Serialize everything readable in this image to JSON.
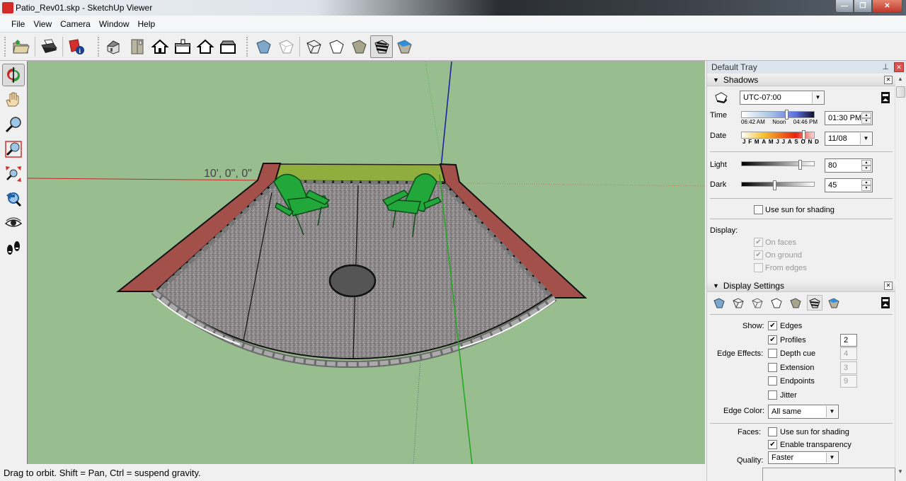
{
  "window": {
    "title": "Patio_Rev01.skp - SketchUp Viewer",
    "minimize_glyph": "—",
    "restore_glyph": "❐",
    "close_glyph": "✕"
  },
  "menu": [
    {
      "label": "File",
      "accel": "F"
    },
    {
      "label": "View",
      "accel": "V"
    },
    {
      "label": "Camera",
      "accel": "C"
    },
    {
      "label": "Window",
      "accel": "W"
    },
    {
      "label": "Help",
      "accel": "H"
    }
  ],
  "toolbar": {
    "file_tools": [
      "open-icon",
      "print-icon",
      "model-info-icon"
    ],
    "view_tools": [
      "iso-view-icon",
      "top-view-icon",
      "front-view-icon",
      "right-view-icon",
      "back-view-icon",
      "left-view-icon"
    ],
    "style_tools": [
      "xray-icon",
      "back-edges-icon",
      "wireframe-icon",
      "hidden-line-icon",
      "shaded-icon",
      "shaded-textures-icon",
      "monochrome-icon"
    ],
    "active_style": "shaded-textures-icon"
  },
  "camera_tools": [
    "orbit-icon",
    "pan-icon",
    "zoom-icon",
    "zoom-window-icon",
    "zoom-extents-icon",
    "previous-view-icon",
    "look-around-icon",
    "walk-icon"
  ],
  "active_camera_tool": "orbit-icon",
  "viewport": {
    "dimension_label": "10', 0\", 0\"",
    "background_color": "#98bd8e",
    "axis_colors": {
      "red": "#c62828",
      "green": "#1fa81f",
      "blue": "#1a1aa0"
    }
  },
  "status": {
    "text": "Drag to orbit. Shift = Pan, Ctrl = suspend gravity."
  },
  "tray": {
    "title": "Default Tray",
    "pin_glyph": "📌",
    "close_glyph": "✕",
    "shadows": {
      "title": "Shadows",
      "timezone": "UTC-07:00",
      "time_label": "Time",
      "time_ticks": [
        "06:42 AM",
        "Noon",
        "04:46 PM"
      ],
      "time_value": "01:30 PM",
      "time_fraction": 0.62,
      "date_label": "Date",
      "date_ticks": [
        "J",
        "F",
        "M",
        "A",
        "M",
        "J",
        "J",
        "A",
        "S",
        "O",
        "N",
        "D"
      ],
      "date_value": "11/08",
      "date_fraction": 0.85,
      "light_label": "Light",
      "light_value": "80",
      "dark_label": "Dark",
      "dark_value": "45",
      "use_sun_label": "Use sun for shading",
      "use_sun_checked": false,
      "display_label": "Display:",
      "display_options": [
        {
          "label": "On faces",
          "checked": true,
          "disabled": true
        },
        {
          "label": "On ground",
          "checked": true,
          "disabled": true
        },
        {
          "label": "From edges",
          "checked": false,
          "disabled": true
        }
      ]
    },
    "display_settings": {
      "title": "Display Settings",
      "styles": [
        "xray-icon",
        "back-edges-icon",
        "wireframe-icon",
        "hidden-line-icon",
        "shaded-icon",
        "shaded-textures-icon",
        "monochrome-icon"
      ],
      "show_label": "Show:",
      "edge_effects_label": "Edge Effects:",
      "edges": [
        {
          "label": "Edges",
          "checked": true,
          "value": null
        },
        {
          "label": "Profiles",
          "checked": true,
          "value": "2"
        },
        {
          "label": "Depth cue",
          "checked": false,
          "value": "4"
        },
        {
          "label": "Extension",
          "checked": false,
          "value": "3"
        },
        {
          "label": "Endpoints",
          "checked": false,
          "value": "9"
        },
        {
          "label": "Jitter",
          "checked": false,
          "value": null
        }
      ],
      "edge_color_label": "Edge Color:",
      "edge_color_value": "All same",
      "faces_label": "Faces:",
      "faces_options": [
        {
          "label": "Use sun for shading",
          "checked": false
        },
        {
          "label": "Enable transparency",
          "checked": true
        }
      ],
      "quality_label": "Quality:",
      "quality_value": "Faster"
    }
  }
}
